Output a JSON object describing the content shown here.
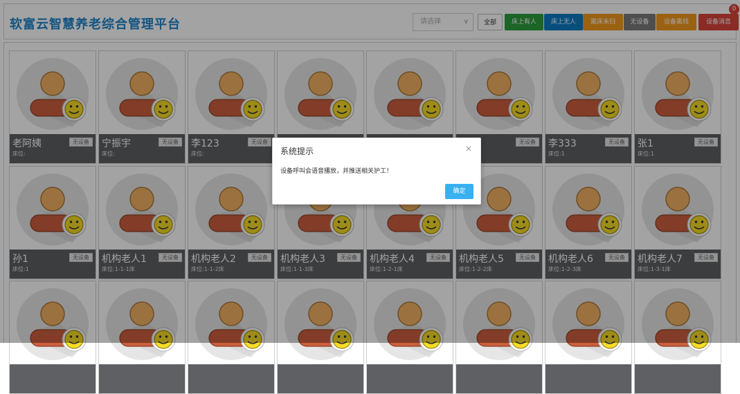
{
  "header": {
    "title": "软富云智慧养老综合管理平台",
    "select_placeholder": "请选择",
    "filters": {
      "all": "全部",
      "on_bed_occupied": "床上有人",
      "on_bed_empty": "床上无人",
      "left_bed_not_returned": "离床未归",
      "no_device": "无设备",
      "device_offline": "设备离线",
      "device_messages": "设备消息"
    },
    "message_count": "0"
  },
  "colors": {
    "title": "#1e84c9",
    "green": "#2d9f3e",
    "blue": "#0a7bc4",
    "orange": "#f39a1e",
    "gray": "#7a7a7a",
    "red": "#d9443b",
    "card_info_bg": "#5e6063",
    "dialog_button": "#39b0f0"
  },
  "residents": [
    {
      "name": "老阿姨",
      "bed": "床位:",
      "status": "无设备"
    },
    {
      "name": "宁振宇",
      "bed": "床位:",
      "status": "无设备"
    },
    {
      "name": "李123",
      "bed": "床位:",
      "status": "无设备"
    },
    {
      "name": "",
      "bed": "",
      "status": ""
    },
    {
      "name": "",
      "bed": "",
      "status": ""
    },
    {
      "name": "",
      "bed": "",
      "status": "无设备"
    },
    {
      "name": "李333",
      "bed": "床位:1",
      "status": "无设备"
    },
    {
      "name": "张1",
      "bed": "床位:1",
      "status": "无设备"
    },
    {
      "name": "孙1",
      "bed": "床位:1",
      "status": "无设备"
    },
    {
      "name": "机构老人1",
      "bed": "床位:1-1-1床",
      "status": "无设备"
    },
    {
      "name": "机构老人2",
      "bed": "床位:1-1-2床",
      "status": "无设备"
    },
    {
      "name": "机构老人3",
      "bed": "床位:1-1-3床",
      "status": "无设备"
    },
    {
      "name": "机构老人4",
      "bed": "床位:1-2-1床",
      "status": "无设备"
    },
    {
      "name": "机构老人5",
      "bed": "床位:1-2-2床",
      "status": "无设备"
    },
    {
      "name": "机构老人6",
      "bed": "床位:1-2-3床",
      "status": "无设备"
    },
    {
      "name": "机构老人7",
      "bed": "床位:1-3-1床",
      "status": "无设备"
    },
    {
      "name": "",
      "bed": "",
      "status": ""
    },
    {
      "name": "",
      "bed": "",
      "status": ""
    },
    {
      "name": "",
      "bed": "",
      "status": ""
    },
    {
      "name": "",
      "bed": "",
      "status": ""
    },
    {
      "name": "",
      "bed": "",
      "status": ""
    },
    {
      "name": "",
      "bed": "",
      "status": ""
    },
    {
      "name": "",
      "bed": "",
      "status": ""
    },
    {
      "name": "",
      "bed": "",
      "status": ""
    }
  ],
  "dialog": {
    "title": "系统提示",
    "close": "×",
    "message": "设备呼叫会语音播放，并推送相关护工！",
    "ok": "确定"
  }
}
